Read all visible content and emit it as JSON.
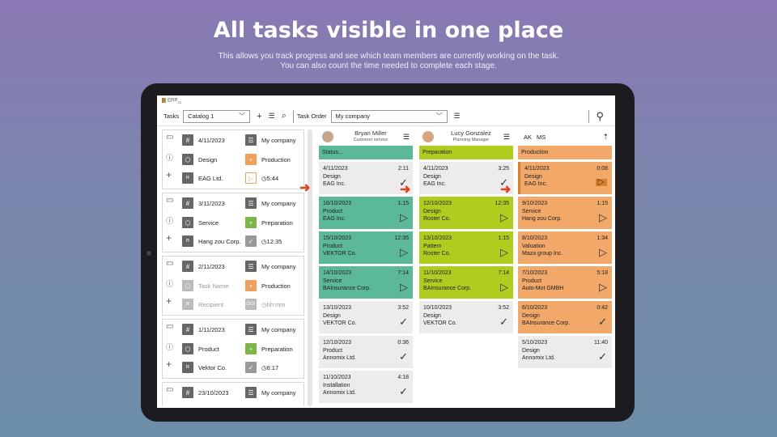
{
  "hero": {
    "title": "All tasks visible in one place",
    "subtitle1": "This allows you track progress and see which team members are currently working on the task.",
    "subtitle2": "You can also count the time needed to complete each stage."
  },
  "app": {
    "logo": "ERP",
    "logo_sub": "24"
  },
  "toolbar": {
    "tasks_label": "Tasks",
    "catalog_value": "Catalog 1",
    "task_order_label": "Task Order",
    "company_value": "My company"
  },
  "task_list": [
    {
      "date": "4/11/2023",
      "company": "My company",
      "type": "Design",
      "stage": "Production",
      "client": "EAG Ltd.",
      "time": "5:44"
    },
    {
      "date": "3/11/2023",
      "company": "My company",
      "type": "Service",
      "stage": "Preparation",
      "client": "Hang zou Corp.",
      "time": "12:35"
    },
    {
      "date": "2/11/2023",
      "company": "My company",
      "type": "Task Name",
      "stage": "Production",
      "client": "Recipient",
      "go": "GO!",
      "time": "hh:mm"
    },
    {
      "date": "1/11/2023",
      "company": "My company",
      "type": "Product",
      "stage": "Preparation",
      "client": "Vektor Co.",
      "time": "6:17"
    },
    {
      "date": "23/10/2023",
      "company": "My company"
    }
  ],
  "columns": [
    {
      "person": "Bryan Miller",
      "role": "Customer service",
      "status": "Status...",
      "cards": [
        {
          "date": "4/11/2023",
          "time": "2:11",
          "type": "Design",
          "client": "EAG Inc."
        },
        {
          "date": "16/10/2023",
          "time": "1:15",
          "type": "Product",
          "client": "EAG Inc."
        },
        {
          "date": "15/10/2023",
          "time": "12:35",
          "type": "Product",
          "client": "VEKTOR Co."
        },
        {
          "date": "14/10/2023",
          "time": "7:14",
          "type": "Service",
          "client": "BAInsurance Corp."
        },
        {
          "date": "13/10/2023",
          "time": "3:52",
          "type": "Design",
          "client": "VEKTOR Co."
        },
        {
          "date": "12/10/2023",
          "time": "0:36",
          "type": "Product",
          "client": "Annomix Ltd."
        },
        {
          "date": "11/10/2023",
          "time": "4:18",
          "type": "Installation",
          "client": "Annomix Ltd."
        }
      ]
    },
    {
      "person": "Lucy Gonzalez",
      "role": "Planning Manager",
      "status": "Preparation",
      "cards": [
        {
          "date": "4/11/2023",
          "time": "3:25",
          "type": "Design",
          "client": "EAG Inc."
        },
        {
          "date": "12/10/2023",
          "time": "12:35",
          "type": "Design",
          "client": "Roster Co."
        },
        {
          "date": "13/10/2023",
          "time": "1:15",
          "type": "Pattern",
          "client": "Roster Co."
        },
        {
          "date": "11/10/2023",
          "time": "7:14",
          "type": "Service",
          "client": "BAInsurance Corp."
        },
        {
          "date": "10/10/2023",
          "time": "3:52",
          "type": "Design",
          "client": "VEKTOR Co."
        }
      ]
    },
    {
      "initials": [
        "AK",
        "MS"
      ],
      "status": "Production",
      "cards": [
        {
          "date": "4/11/2023",
          "time": "0:08",
          "type": "Design",
          "client": "EAG Inc."
        },
        {
          "date": "9/10/2023",
          "time": "1:15",
          "type": "Service",
          "client": "Hang zou Corp."
        },
        {
          "date": "8/10/2023",
          "time": "1:34",
          "type": "Valuation",
          "client": "Maza group Inc."
        },
        {
          "date": "7/10/2023",
          "time": "5:18",
          "type": "Product",
          "client": "Auto-Mot GMBH"
        },
        {
          "date": "6/10/2023",
          "time": "0:42",
          "type": "Design",
          "client": "BAInsurance Corp."
        },
        {
          "date": "5/10/2023",
          "time": "11:40",
          "type": "Design",
          "client": "Annomix Ltd."
        }
      ]
    }
  ]
}
